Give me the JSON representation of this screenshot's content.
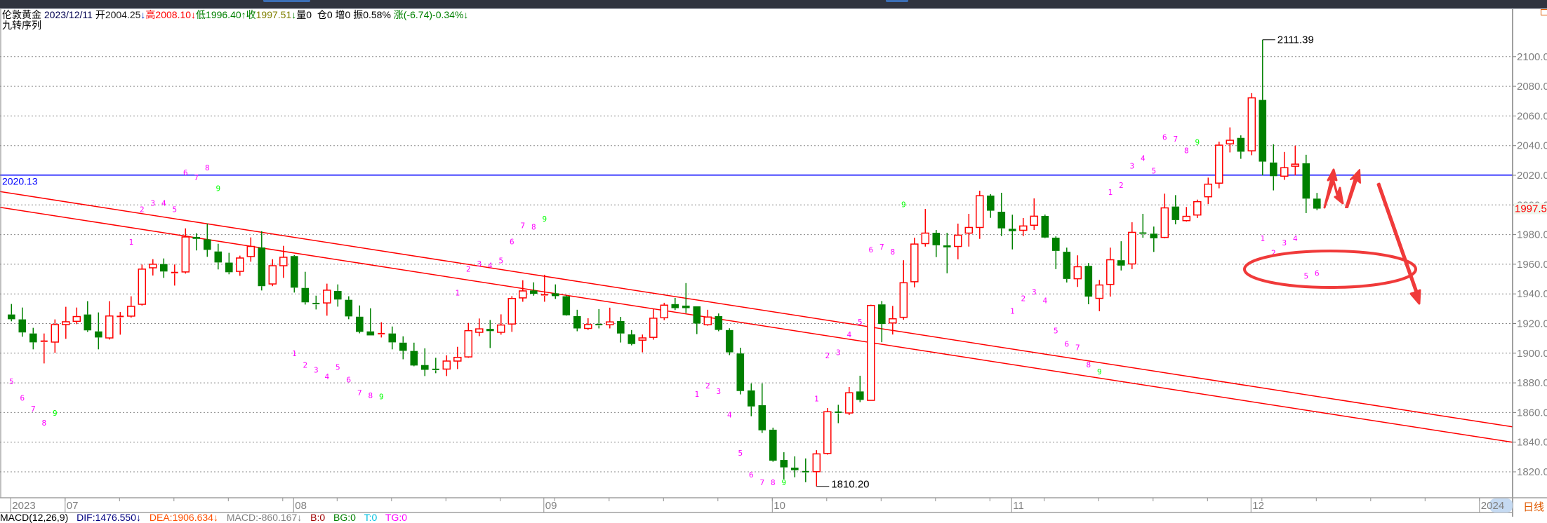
{
  "header": {
    "name": "伦敦黄金",
    "date": "2023/12/11",
    "open_label": "开",
    "open": "2004.25",
    "open_arrow": "↓",
    "high_label": "高",
    "high": "2008.10",
    "high_arrow": "↓",
    "low_label": "低",
    "low": "1996.40",
    "low_arrow": "↑",
    "close_label": "收",
    "close": "1997.51",
    "close_arrow": "↓",
    "volume": "量0",
    "open_interest": "仓0",
    "increase": "增0",
    "amplitude": "振0.58%",
    "change": "涨(-6.74)-0.34%↓"
  },
  "indicator_title": "九转序列",
  "macd": {
    "title": "MACD(12,26,9)",
    "dif": "DIF:1476.550↓",
    "dea": "DEA:1906.634↓",
    "macd": "MACD:-860.167↓",
    "b": "B:0",
    "bg": "BG:0",
    "t": "T:0",
    "tg": "TG:0"
  },
  "period": "日线",
  "colors": {
    "up": "#ff0000",
    "down": "#008000",
    "hline": "#0000ff",
    "trendline": "#ff0000",
    "td_count": "#ff00ff",
    "td_nine": "#00ff00",
    "annotation": "#f03a3a"
  },
  "chart_data": {
    "type": "candlestick",
    "ylim": [
      1802,
      2133
    ],
    "y_ticks": [
      "2100.00",
      "2080.00",
      "2060.00",
      "2040.00",
      "2020.00",
      "2000.00",
      "1980.00",
      "1960.00",
      "1940.00",
      "1920.00",
      "1900.00",
      "1880.00",
      "1860.00",
      "1840.00",
      "1820.00"
    ],
    "grid": true,
    "x_labels": [
      {
        "label": "2023",
        "candle": 0
      },
      {
        "label": "07",
        "candle": 5
      },
      {
        "label": "08",
        "candle": 26
      },
      {
        "label": "09",
        "candle": 49
      },
      {
        "label": "10",
        "candle": 70
      },
      {
        "label": "11",
        "candle": 92
      },
      {
        "label": "12",
        "candle": 114
      },
      {
        "label": "2024",
        "candle": 135
      }
    ],
    "candles_ohlc": [
      [
        1926.1,
        1933.2,
        1921.5,
        1922.9
      ],
      [
        1922.8,
        1930.8,
        1911.1,
        1914.0
      ],
      [
        1913.3,
        1917.1,
        1902.6,
        1907.3
      ],
      [
        1908.0,
        1913.3,
        1893.1,
        1908.1
      ],
      [
        1907.5,
        1922.8,
        1900.2,
        1919.3
      ],
      [
        1919.3,
        1931.3,
        1909.7,
        1921.2
      ],
      [
        1921.5,
        1930.8,
        1919.6,
        1924.7
      ],
      [
        1926.1,
        1935.1,
        1914.4,
        1915.4
      ],
      [
        1914.7,
        1927.5,
        1902.6,
        1910.6
      ],
      [
        1910.3,
        1935.1,
        1909.2,
        1925.1
      ],
      [
        1924.7,
        1927.8,
        1912.5,
        1924.8
      ],
      [
        1925.0,
        1938.4,
        1924.0,
        1931.6
      ],
      [
        1933.0,
        1959.8,
        1932.1,
        1956.7
      ],
      [
        1957.6,
        1963.4,
        1952.4,
        1960.0
      ],
      [
        1960.1,
        1963.9,
        1950.8,
        1955.1
      ],
      [
        1954.3,
        1959.8,
        1945.6,
        1954.4
      ],
      [
        1954.8,
        1984.2,
        1953.7,
        1978.4
      ],
      [
        1978.4,
        1980.9,
        1969.3,
        1977.1
      ],
      [
        1976.8,
        1987.4,
        1965.0,
        1969.7
      ],
      [
        1968.6,
        1973.8,
        1956.5,
        1961.2
      ],
      [
        1961.1,
        1967.7,
        1953.2,
        1954.6
      ],
      [
        1955.2,
        1965.8,
        1952.2,
        1964.2
      ],
      [
        1965.2,
        1978.1,
        1961.7,
        1972.0
      ],
      [
        1971.3,
        1982.3,
        1942.3,
        1945.2
      ],
      [
        1946.7,
        1963.4,
        1945.2,
        1959.0
      ],
      [
        1959.0,
        1972.4,
        1950.8,
        1964.7
      ],
      [
        1965.5,
        1966.1,
        1940.9,
        1944.2
      ],
      [
        1944.0,
        1954.9,
        1932.8,
        1934.3
      ],
      [
        1933.5,
        1938.8,
        1929.5,
        1933.4
      ],
      [
        1933.9,
        1946.9,
        1925.3,
        1942.5
      ],
      [
        1942.0,
        1946.4,
        1931.4,
        1936.2
      ],
      [
        1936.0,
        1938.4,
        1922.9,
        1924.8
      ],
      [
        1924.6,
        1932.2,
        1913.4,
        1914.4
      ],
      [
        1914.7,
        1930.3,
        1912.0,
        1912.0
      ],
      [
        1913.0,
        1920.9,
        1910.6,
        1913.2
      ],
      [
        1913.3,
        1918.0,
        1902.6,
        1907.3
      ],
      [
        1907.1,
        1911.4,
        1895.9,
        1901.6
      ],
      [
        1901.5,
        1907.1,
        1891.2,
        1891.7
      ],
      [
        1892.0,
        1903.3,
        1884.6,
        1888.8
      ],
      [
        1889.1,
        1896.9,
        1886.5,
        1889.0
      ],
      [
        1889.3,
        1898.6,
        1884.6,
        1894.7
      ],
      [
        1894.7,
        1904.3,
        1889.3,
        1897.2
      ],
      [
        1897.5,
        1920.4,
        1896.9,
        1915.2
      ],
      [
        1914.1,
        1923.4,
        1911.5,
        1916.4
      ],
      [
        1916.4,
        1922.4,
        1903.5,
        1914.9
      ],
      [
        1914.1,
        1926.2,
        1912.5,
        1919.0
      ],
      [
        1919.7,
        1938.5,
        1914.4,
        1936.9
      ],
      [
        1937.3,
        1949.2,
        1934.7,
        1942.0
      ],
      [
        1942.3,
        1947.8,
        1938.8,
        1940.1
      ],
      [
        1939.3,
        1952.9,
        1934.7,
        1939.4
      ],
      [
        1940.4,
        1946.4,
        1936.6,
        1938.5
      ],
      [
        1938.4,
        1939.0,
        1925.3,
        1925.6
      ],
      [
        1925.0,
        1929.3,
        1914.8,
        1916.7
      ],
      [
        1916.7,
        1923.6,
        1915.7,
        1919.3
      ],
      [
        1919.3,
        1929.7,
        1916.7,
        1918.7
      ],
      [
        1919.2,
        1930.7,
        1916.7,
        1921.1
      ],
      [
        1921.7,
        1924.5,
        1907.2,
        1913.3
      ],
      [
        1912.7,
        1915.6,
        1905.3,
        1906.2
      ],
      [
        1908.8,
        1912.6,
        1900.6,
        1910.3
      ],
      [
        1910.7,
        1929.9,
        1909.1,
        1923.6
      ],
      [
        1923.9,
        1934.0,
        1922.3,
        1932.4
      ],
      [
        1933.1,
        1937.3,
        1929.1,
        1930.4
      ],
      [
        1932.1,
        1947.3,
        1927.1,
        1930.4
      ],
      [
        1931.6,
        1931.6,
        1912.9,
        1920.0
      ],
      [
        1919.2,
        1929.3,
        1918.5,
        1924.4
      ],
      [
        1925.0,
        1926.8,
        1914.8,
        1915.7
      ],
      [
        1915.6,
        1916.8,
        1898.7,
        1900.6
      ],
      [
        1899.8,
        1903.7,
        1872.2,
        1874.5
      ],
      [
        1874.9,
        1879.6,
        1857.5,
        1864.1
      ],
      [
        1864.9,
        1879.6,
        1846.2,
        1848.0
      ],
      [
        1848.4,
        1849.8,
        1826.8,
        1827.5
      ],
      [
        1828.0,
        1833.2,
        1815.1,
        1823.0
      ],
      [
        1822.8,
        1830.4,
        1816.3,
        1821.1
      ],
      [
        1820.1,
        1829.0,
        1813.0,
        1820.0
      ],
      [
        1820.1,
        1834.6,
        1810.2,
        1832.1
      ],
      [
        1832.4,
        1863.0,
        1831.6,
        1860.5
      ],
      [
        1860.2,
        1865.2,
        1852.8,
        1860.1
      ],
      [
        1859.7,
        1877.2,
        1858.3,
        1873.3
      ],
      [
        1874.2,
        1884.8,
        1867.0,
        1868.5
      ],
      [
        1868.2,
        1932.7,
        1868.2,
        1932.2
      ],
      [
        1932.9,
        1935.2,
        1907.4,
        1919.7
      ],
      [
        1920.4,
        1931.9,
        1912.6,
        1923.2
      ],
      [
        1924.2,
        1962.7,
        1922.6,
        1947.5
      ],
      [
        1948.2,
        1977.9,
        1944.4,
        1973.6
      ],
      [
        1973.9,
        1997.3,
        1971.9,
        1981.0
      ],
      [
        1981.2,
        1983.1,
        1964.8,
        1972.8
      ],
      [
        1972.7,
        1981.2,
        1953.9,
        1971.4
      ],
      [
        1972.0,
        1987.4,
        1963.3,
        1979.6
      ],
      [
        1981.0,
        1994.0,
        1971.9,
        1984.8
      ],
      [
        1984.8,
        2009.6,
        1977.1,
        2006.2
      ],
      [
        2006.3,
        2007.3,
        1991.3,
        1996.1
      ],
      [
        1995.4,
        2008.2,
        1979.0,
        1984.2
      ],
      [
        1983.9,
        1993.4,
        1970.0,
        1982.3
      ],
      [
        1982.9,
        1991.2,
        1979.0,
        1985.8
      ],
      [
        1986.3,
        2004.4,
        1983.1,
        1992.4
      ],
      [
        1992.6,
        1993.5,
        1977.6,
        1978.0
      ],
      [
        1977.9,
        1978.8,
        1956.7,
        1969.0
      ],
      [
        1968.4,
        1971.2,
        1947.7,
        1950.1
      ],
      [
        1950.2,
        1966.0,
        1944.7,
        1958.3
      ],
      [
        1958.9,
        1960.8,
        1933.0,
        1938.2
      ],
      [
        1937.0,
        1949.4,
        1928.3,
        1946.0
      ],
      [
        1946.4,
        1971.2,
        1938.2,
        1963.0
      ],
      [
        1962.7,
        1975.5,
        1955.8,
        1959.1
      ],
      [
        1960.2,
        1988.3,
        1956.7,
        1981.5
      ],
      [
        1981.0,
        1994.0,
        1977.9,
        1980.9
      ],
      [
        1980.6,
        1985.4,
        1968.3,
        1977.5
      ],
      [
        1978.1,
        2007.6,
        1977.5,
        1998.0
      ],
      [
        1998.9,
        2006.6,
        1986.9,
        1989.8
      ],
      [
        1989.4,
        1998.6,
        1988.8,
        1992.3
      ],
      [
        1993.2,
        2003.6,
        1991.2,
        2002.2
      ],
      [
        2005.5,
        2018.4,
        2000.6,
        2014.0
      ],
      [
        2014.7,
        2042.7,
        2011.2,
        2040.3
      ],
      [
        2041.2,
        2052.3,
        2035.4,
        2043.6
      ],
      [
        2045.2,
        2046.9,
        2031.1,
        2035.9
      ],
      [
        2036.5,
        2075.4,
        2033.5,
        2072.2
      ],
      [
        2070.8,
        2111.39,
        2019.9,
        2029.2
      ],
      [
        2028.6,
        2040.9,
        2009.8,
        2019.4
      ],
      [
        2019.4,
        2035.7,
        2016.9,
        2025.1
      ],
      [
        2026.1,
        2040.0,
        2019.9,
        2027.5
      ],
      [
        2028.1,
        2033.8,
        1994.5,
        2004.25
      ],
      [
        2004.25,
        2008.1,
        1996.4,
        1997.51
      ]
    ],
    "horizontal_line": {
      "value": 2020.13,
      "label": "2020.13"
    },
    "trendlines": [
      {
        "from": [
          -1.05,
          2009.0
        ],
        "to": [
          138.0,
          1850.3
        ]
      },
      {
        "from": [
          -1.05,
          1998.4
        ],
        "to": [
          138.0,
          1839.9
        ]
      }
    ],
    "high_marker": {
      "candle": 115,
      "value": "2111.39"
    },
    "low_marker": {
      "candle": 74,
      "value": "1810.20"
    },
    "last_price": "1997.51",
    "td_sequential": [
      {
        "i": 0,
        "t": "5",
        "p": 1880.9
      },
      {
        "i": 1,
        "t": "6",
        "p": 1870.0
      },
      {
        "i": 2,
        "t": "7",
        "p": 1862.5
      },
      {
        "i": 3,
        "t": "8",
        "p": 1853.0
      },
      {
        "i": 4,
        "t": "9",
        "p": 1859.7
      },
      {
        "i": 11,
        "t": "1",
        "p": 1975.1
      },
      {
        "i": 12,
        "t": "2",
        "p": 1997.0
      },
      {
        "i": 13,
        "t": "3",
        "p": 2001.3
      },
      {
        "i": 14,
        "t": "4",
        "p": 2001.3
      },
      {
        "i": 15,
        "t": "5",
        "p": 1997.0
      },
      {
        "i": 16,
        "t": "6",
        "p": 2022.0
      },
      {
        "i": 17,
        "t": "7",
        "p": 2018.6
      },
      {
        "i": 18,
        "t": "8",
        "p": 2025.2
      },
      {
        "i": 19,
        "t": "9",
        "p": 2011.2
      },
      {
        "i": 26,
        "t": "1",
        "p": 1900.0
      },
      {
        "i": 27,
        "t": "2",
        "p": 1892.1
      },
      {
        "i": 28,
        "t": "3",
        "p": 1888.7
      },
      {
        "i": 29,
        "t": "4",
        "p": 1884.3
      },
      {
        "i": 30,
        "t": "5",
        "p": 1890.6
      },
      {
        "i": 31,
        "t": "6",
        "p": 1882.1
      },
      {
        "i": 32,
        "t": "7",
        "p": 1873.5
      },
      {
        "i": 33,
        "t": "8",
        "p": 1871.6
      },
      {
        "i": 34,
        "t": "9",
        "p": 1870.9
      },
      {
        "i": 41,
        "t": "1",
        "p": 1940.9
      },
      {
        "i": 42,
        "t": "2",
        "p": 1956.8
      },
      {
        "i": 43,
        "t": "3",
        "p": 1960.4
      },
      {
        "i": 44,
        "t": "4",
        "p": 1959.3
      },
      {
        "i": 45,
        "t": "5",
        "p": 1962.6
      },
      {
        "i": 46,
        "t": "6",
        "p": 1975.3
      },
      {
        "i": 47,
        "t": "7",
        "p": 1986.2
      },
      {
        "i": 48,
        "t": "8",
        "p": 1985.2
      },
      {
        "i": 49,
        "t": "9",
        "p": 1990.6
      },
      {
        "i": 63,
        "t": "1",
        "p": 1872.5
      },
      {
        "i": 64,
        "t": "2",
        "p": 1878.2
      },
      {
        "i": 65,
        "t": "3",
        "p": 1874.4
      },
      {
        "i": 66,
        "t": "4",
        "p": 1858.6
      },
      {
        "i": 67,
        "t": "5",
        "p": 1832.7
      },
      {
        "i": 68,
        "t": "6",
        "p": 1818.1
      },
      {
        "i": 69,
        "t": "7",
        "p": 1813.0
      },
      {
        "i": 70,
        "t": "8",
        "p": 1813.0
      },
      {
        "i": 71,
        "t": "9",
        "p": 1813.0
      },
      {
        "i": 74,
        "t": "1",
        "p": 1869.5
      },
      {
        "i": 75,
        "t": "2",
        "p": 1898.5
      },
      {
        "i": 76,
        "t": "3",
        "p": 1900.7
      },
      {
        "i": 77,
        "t": "4",
        "p": 1912.6
      },
      {
        "i": 78,
        "t": "5",
        "p": 1921.1
      },
      {
        "i": 79,
        "t": "6",
        "p": 1969.8
      },
      {
        "i": 80,
        "t": "7",
        "p": 1971.7
      },
      {
        "i": 81,
        "t": "8",
        "p": 1968.4
      },
      {
        "i": 82,
        "t": "9",
        "p": 2000.3
      },
      {
        "i": 92,
        "t": "1",
        "p": 1928.6
      },
      {
        "i": 93,
        "t": "2",
        "p": 1937.1
      },
      {
        "i": 94,
        "t": "3",
        "p": 1941.4
      },
      {
        "i": 95,
        "t": "4",
        "p": 1935.5
      },
      {
        "i": 96,
        "t": "5",
        "p": 1915.2
      },
      {
        "i": 97,
        "t": "6",
        "p": 1906.3
      },
      {
        "i": 98,
        "t": "7",
        "p": 1903.9
      },
      {
        "i": 99,
        "t": "8",
        "p": 1892.3
      },
      {
        "i": 100,
        "t": "9",
        "p": 1887.5
      },
      {
        "i": 101,
        "t": "1",
        "p": 2008.7
      },
      {
        "i": 102,
        "t": "2",
        "p": 2013.4
      },
      {
        "i": 103,
        "t": "3",
        "p": 2026.5
      },
      {
        "i": 104,
        "t": "4",
        "p": 2031.7
      },
      {
        "i": 105,
        "t": "5",
        "p": 2023.1
      },
      {
        "i": 106,
        "t": "6",
        "p": 2045.8
      },
      {
        "i": 107,
        "t": "7",
        "p": 2044.7
      },
      {
        "i": 108,
        "t": "8",
        "p": 2036.9
      },
      {
        "i": 109,
        "t": "9",
        "p": 2042.4
      },
      {
        "i": 115,
        "t": "1",
        "p": 1977.4
      },
      {
        "i": 116,
        "t": "2",
        "p": 1967.7
      },
      {
        "i": 117,
        "t": "3",
        "p": 1974.6
      },
      {
        "i": 118,
        "t": "4",
        "p": 1977.4
      },
      {
        "i": 119,
        "t": "5",
        "p": 1952.2
      },
      {
        "i": 120,
        "t": "6",
        "p": 1954.1
      }
    ]
  }
}
